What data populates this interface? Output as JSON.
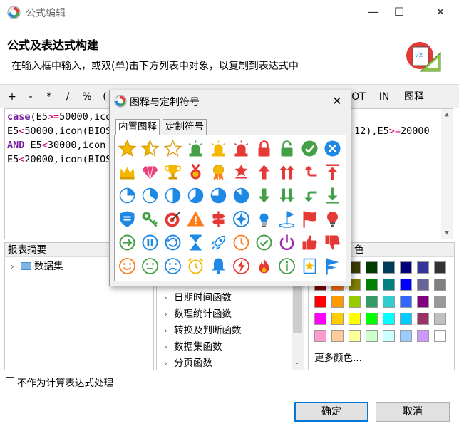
{
  "window": {
    "title": "公式编辑",
    "minimize": "—",
    "maximize": "☐",
    "close": "✕"
  },
  "header": {
    "title": "公式及表达式构建",
    "description": "在输入框中输入，或双(单)击下方列表中对象，以复制到表达式中"
  },
  "toolbar": {
    "buttons": [
      "+",
      "-",
      "*",
      "/",
      "%",
      "(",
      "OT",
      "IN",
      "图释"
    ]
  },
  "editor": {
    "lines": [
      [
        {
          "t": "case",
          "k": "kw"
        },
        {
          "t": "(E5"
        },
        {
          "t": ">=",
          "k": "op"
        },
        {
          "t": "50000,icon"
        }
      ],
      [
        {
          "t": "E5"
        },
        {
          "t": "<",
          "k": "op"
        },
        {
          "t": "50000,icon(BIOS"
        }
      ],
      [
        {
          "t": "AND",
          "k": "kw"
        },
        {
          "t": " E5"
        },
        {
          "t": "<",
          "k": "op"
        },
        {
          "t": "30000,icon"
        }
      ],
      [
        {
          "t": "E5"
        },
        {
          "t": "<",
          "k": "op"
        },
        {
          "t": "20000,icon(BIOS"
        }
      ]
    ],
    "line2_tail": [
      {
        "t": "12),E5"
      },
      {
        "t": ">=",
        "k": "op"
      },
      {
        "t": "20000"
      }
    ]
  },
  "summary_panel": {
    "title": "报表摘要",
    "tree": [
      {
        "label": "数据集"
      }
    ]
  },
  "functions_panel": {
    "items": [
      "日期时间函数",
      "数理统计函数",
      "转换及判断函数",
      "数据集函数",
      "分页函数"
    ]
  },
  "color_panel": {
    "title": "色",
    "colors": [
      "#000000",
      "#7b3f00",
      "#3c3c00",
      "#003c00",
      "#003c5a",
      "#00007b",
      "#333399",
      "#333333",
      "#800000",
      "#ff6600",
      "#808000",
      "#008000",
      "#008080",
      "#0000ff",
      "#666699",
      "#808080",
      "#ff0000",
      "#ff9900",
      "#99cc00",
      "#339966",
      "#33cccc",
      "#3366ff",
      "#800080",
      "#999999",
      "#ff00ff",
      "#ffcc00",
      "#ffff00",
      "#00ff00",
      "#00ffff",
      "#00ccff",
      "#993366",
      "#c0c0c0",
      "#ff99cc",
      "#ffcc99",
      "#ffff99",
      "#ccffcc",
      "#ccffff",
      "#99ccff",
      "#cc99ff",
      "#ffffff"
    ],
    "more_colors": "更多颜色..."
  },
  "checkbox": {
    "label": "不作为计算表达式处理"
  },
  "buttons": {
    "ok": "确定",
    "cancel": "取消"
  },
  "popup": {
    "title": "图释与定制符号",
    "close": "✕",
    "tabs": [
      "内置图释",
      "定制符号"
    ],
    "icons": [
      "star-full-icon",
      "star-half-icon",
      "star-empty-icon",
      "alarm-light-green-icon",
      "alarm-light-yellow-icon",
      "alarm-light-red-icon",
      "lock-closed-icon",
      "lock-open-icon",
      "check-circle-icon",
      "x-circle-icon",
      "crown-icon",
      "diamond-icon",
      "trophy-icon",
      "medal-icon",
      "award-ribbon-icon",
      "star-badge-icon",
      "arrow-up-icon",
      "double-arrow-up-icon",
      "turn-up-icon",
      "arrow-up-top-icon",
      "pie-quarter-icon",
      "pie-third-icon",
      "pie-half-icon",
      "pie-two-thirds-icon",
      "pie-three-quarters-icon",
      "pie-most-icon",
      "arrow-down-icon",
      "double-arrow-down-icon",
      "turn-down-icon",
      "arrow-down-bottom-icon",
      "shield-icon",
      "key-icon",
      "target-icon",
      "warning-icon",
      "signpost-icon",
      "compass-icon",
      "lightbulb-icon",
      "flag-golf-icon",
      "flag-red-icon",
      "bulb-red-icon",
      "arrow-right-circle-icon",
      "pause-circle-icon",
      "undo-circle-icon",
      "hourglass-icon",
      "rocket-icon",
      "clock-icon",
      "check-outline-icon",
      "power-icon",
      "thumb-up-icon",
      "thumb-down-icon",
      "smile-icon",
      "neutral-icon",
      "sad-icon",
      "alarm-clock-icon",
      "bell-icon",
      "lightning-icon",
      "fire-icon",
      "info-icon",
      "star-bookmark-icon",
      "flag-blue-icon"
    ]
  }
}
